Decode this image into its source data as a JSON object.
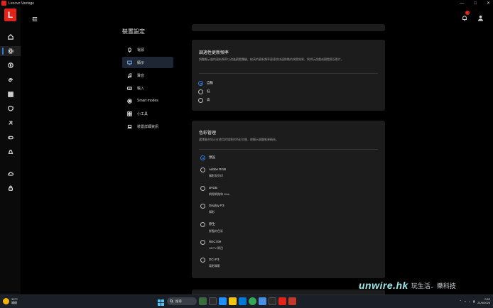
{
  "window": {
    "title": "Lenovo Vantage"
  },
  "rail": {
    "logo": "L",
    "items": [
      "home-icon",
      "gear-icon",
      "dollar-icon",
      "spiral-icon",
      "grid-icon",
      "shield-icon",
      "tools-icon",
      "game-icon",
      "device-icon",
      "cloud-icon",
      "lock-icon"
    ]
  },
  "settings": {
    "title": "裝置設定",
    "nav": [
      {
        "label": "電源",
        "icon": "bulb-icon"
      },
      {
        "label": "顯示",
        "icon": "monitor-icon",
        "active": true
      },
      {
        "label": "聲音",
        "icon": "music-icon"
      },
      {
        "label": "輸入",
        "icon": "keyboard-icon"
      },
      {
        "label": "Smart modes",
        "icon": "smart-icon"
      },
      {
        "label": "小工具",
        "icon": "widget-icon"
      },
      {
        "label": "裝置詳細資訊",
        "icon": "laptop-icon"
      }
    ]
  },
  "refresh": {
    "title": "調適性更新頻率",
    "desc": "調整顯示器的更新頻率以改進觀看體驗。較高的更新頻率更適合快速移動的視覺效果，例如玩遊戲或觀看實況影片。",
    "options": [
      "自動",
      "低",
      "高"
    ],
    "selected": 0
  },
  "color": {
    "title": "色彩管理",
    "desc": "選擇最合您正在使用的場景的色彩空間，使顯示器顯象更精亮。",
    "options": [
      {
        "label": "預設",
        "sub": ""
      },
      {
        "label": "Adobe RGB",
        "sub": "攝影和列印"
      },
      {
        "label": "sRGB",
        "sub": "網際網路和 Web"
      },
      {
        "label": "Display P3",
        "sub": "攝影"
      },
      {
        "label": "原生",
        "sub": "鮮豔的色彩"
      },
      {
        "label": "REC709",
        "sub": "HDTV 節目"
      },
      {
        "label": "DCI P3",
        "sub": "電影攝影"
      }
    ],
    "selected": 0
  },
  "taskbar": {
    "weather_temp": "30°C",
    "weather_desc": "晴朗",
    "search": "搜尋",
    "time": "0:52",
    "date": "21/6/2026"
  },
  "watermark": {
    "brand": "unwire.hk",
    "tagline": "玩生活．樂科技"
  },
  "colors": {
    "accent": "#2f7de1",
    "brand": "#e2231a"
  }
}
